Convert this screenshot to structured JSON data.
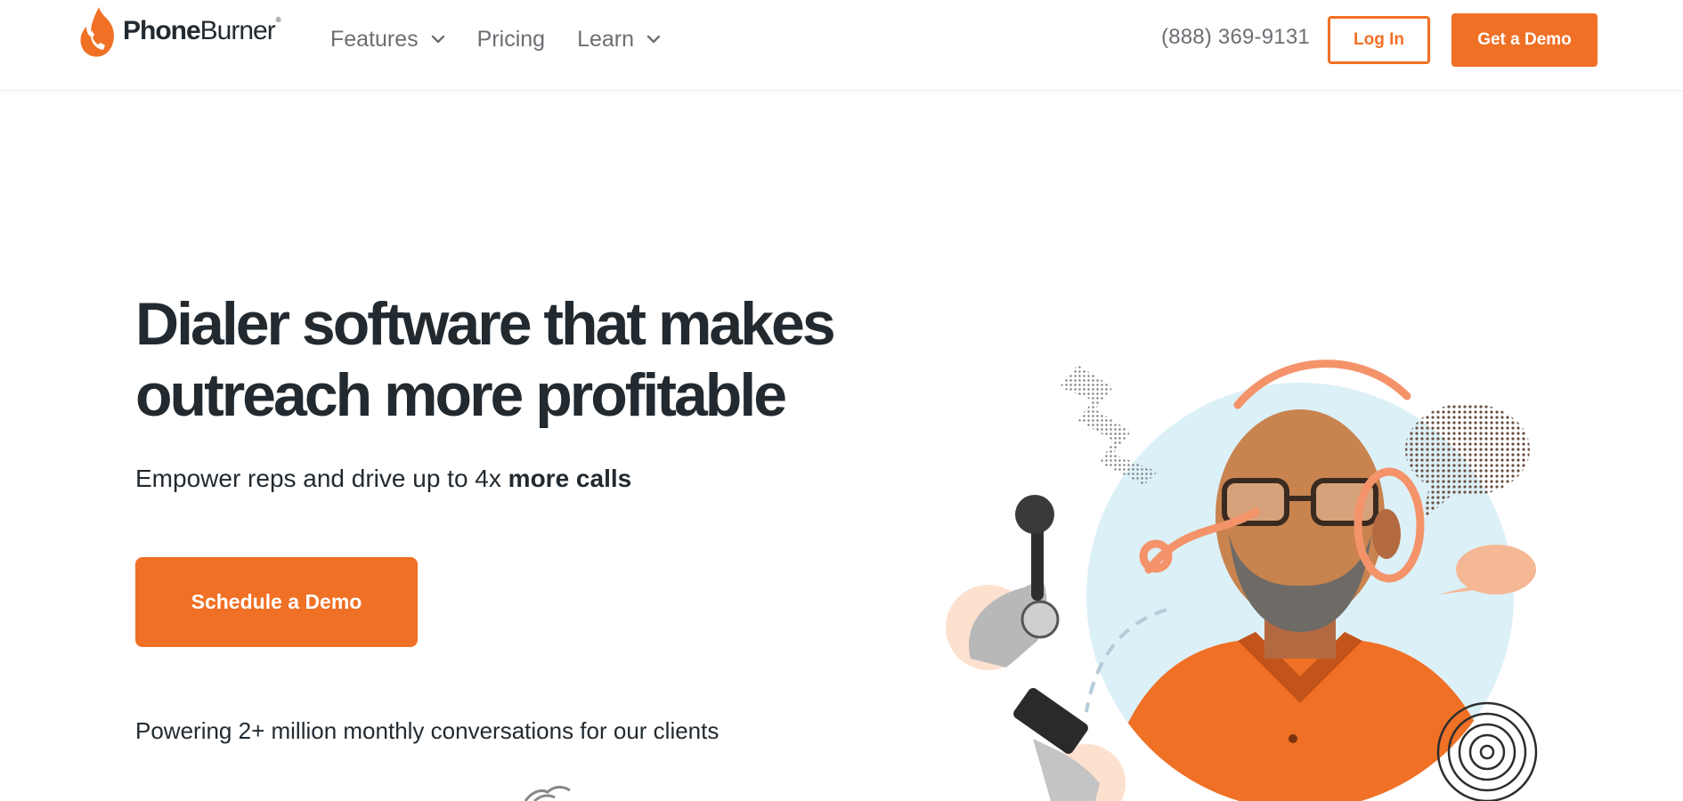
{
  "brand": {
    "name_bold": "Phone",
    "name_light": "Burner",
    "trademark": "®",
    "accent": "#f07025",
    "text_dark": "#222a30",
    "nav_gray": "#6b6f73",
    "circle_blue": "#dcf0f7"
  },
  "header": {
    "nav": [
      {
        "label": "Features",
        "has_dropdown": true
      },
      {
        "label": "Pricing",
        "has_dropdown": false
      },
      {
        "label": "Learn",
        "has_dropdown": true
      }
    ],
    "phone": "(888) 369-9131",
    "login_label": "Log In",
    "demo_label": "Get a Demo"
  },
  "hero": {
    "title_line1": "Dialer software that makes",
    "title_line2": "outreach more profitable",
    "subtitle_prefix": "Empower reps and drive up to 4x ",
    "subtitle_emphasis": "more calls",
    "cta_label": "Schedule a Demo",
    "social_proof": "Powering 2+ million monthly conversations for our clients"
  },
  "illustration": {
    "subject": "man-with-headset-portrait",
    "decorations": [
      "telephone-handset-icon",
      "smartphone-icon",
      "speech-bubble-icon",
      "zigzag-pattern",
      "concentric-circles"
    ]
  }
}
